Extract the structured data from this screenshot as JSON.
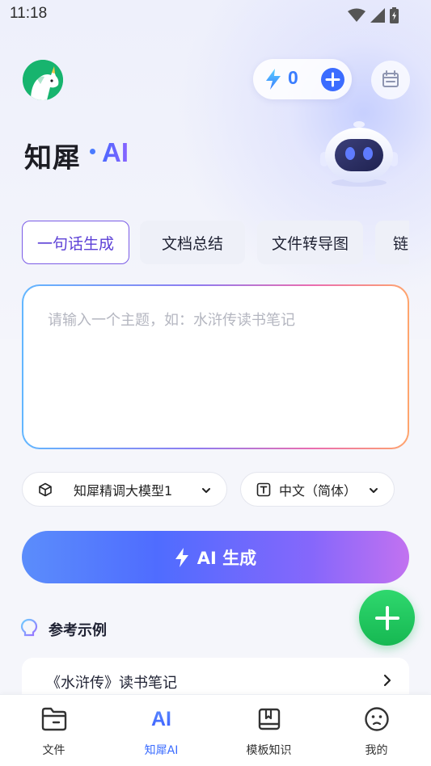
{
  "status_bar": {
    "time": "11:18"
  },
  "header": {
    "energy_count": "0",
    "brand_name": "知犀",
    "brand_ai": "AI"
  },
  "tabs": [
    {
      "label": "一句话生成",
      "active": true
    },
    {
      "label": "文档总结",
      "active": false
    },
    {
      "label": "文件转导图",
      "active": false
    },
    {
      "label": "链",
      "active": false
    }
  ],
  "prompt": {
    "placeholder": "请输入一个主题，如：水浒传读书笔记",
    "value": ""
  },
  "selectors": {
    "model": "知犀精调大模型1",
    "language": "中文（简体）"
  },
  "generate_button": {
    "label": "AI 生成"
  },
  "examples": {
    "title": "参考示例",
    "items": [
      {
        "label": "《水浒传》读书笔记"
      }
    ]
  },
  "bottom_nav": [
    {
      "label": "文件",
      "icon": "folder-icon",
      "active": false
    },
    {
      "label": "知犀AI",
      "icon": "ai-icon",
      "active": true
    },
    {
      "label": "模板知识",
      "icon": "book-icon",
      "active": false
    },
    {
      "label": "我的",
      "icon": "face-icon",
      "active": false
    }
  ],
  "colors": {
    "accent": "#3b6cff",
    "tab_active_border": "#7b5ce6",
    "fab": "#1fc55f",
    "logo": "#17b46e"
  }
}
